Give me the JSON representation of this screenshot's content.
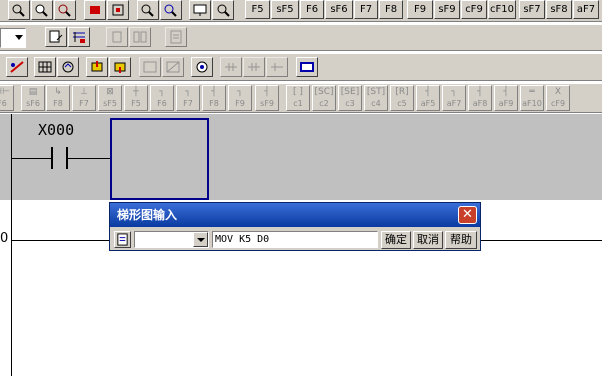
{
  "toolbar_row1": {
    "fkeys": [
      "F5",
      "sF5",
      "F6",
      "sF6",
      "F7",
      "F8",
      "F9",
      "sF9",
      "cF9",
      "cF10",
      "sF7",
      "sF8",
      "aF7"
    ]
  },
  "ladder_keys": [
    {
      "sym": "⊣⊢",
      "cap": "F6"
    },
    {
      "sym": "▤",
      "cap": "sF6"
    },
    {
      "sym": "↳",
      "cap": "F8"
    },
    {
      "sym": "⊥",
      "cap": "F7"
    },
    {
      "sym": "⊠",
      "cap": "sF5"
    },
    {
      "sym": "┼",
      "cap": "F5"
    },
    {
      "sym": "┐",
      "cap": "F6"
    },
    {
      "sym": "┐",
      "cap": "F7"
    },
    {
      "sym": "┤",
      "cap": "F8"
    },
    {
      "sym": "┐",
      "cap": "F9"
    },
    {
      "sym": "┤",
      "cap": "sF9"
    },
    {
      "sym": "[ ]",
      "cap": "c1"
    },
    {
      "sym": "[SC]",
      "cap": "c2"
    },
    {
      "sym": "[SE]",
      "cap": "c3"
    },
    {
      "sym": "[ST]",
      "cap": "c4"
    },
    {
      "sym": "[R]",
      "cap": "c5"
    },
    {
      "sym": "┤",
      "cap": "aF5"
    },
    {
      "sym": "┐",
      "cap": "aF7"
    },
    {
      "sym": "┤",
      "cap": "aF8"
    },
    {
      "sym": "┤",
      "cap": "aF9"
    },
    {
      "sym": "═",
      "cap": "aF10"
    },
    {
      "sym": "X",
      "cap": "cF9"
    }
  ],
  "ladder": {
    "contact_label": "X000",
    "rung2_step": "0"
  },
  "dialog": {
    "title": "梯形图输入",
    "close": "✕",
    "input_value": "MOV K5 D0",
    "ok_label": "确定",
    "cancel_label": "取消",
    "help_label": "帮助"
  },
  "colors": {
    "toolbar_bg": "#d4d0c8",
    "ladder_gray": "#c0c0c0",
    "cursor": "#00008b",
    "title_bar": "#0a3aa0",
    "close_button": "#c8402a"
  }
}
